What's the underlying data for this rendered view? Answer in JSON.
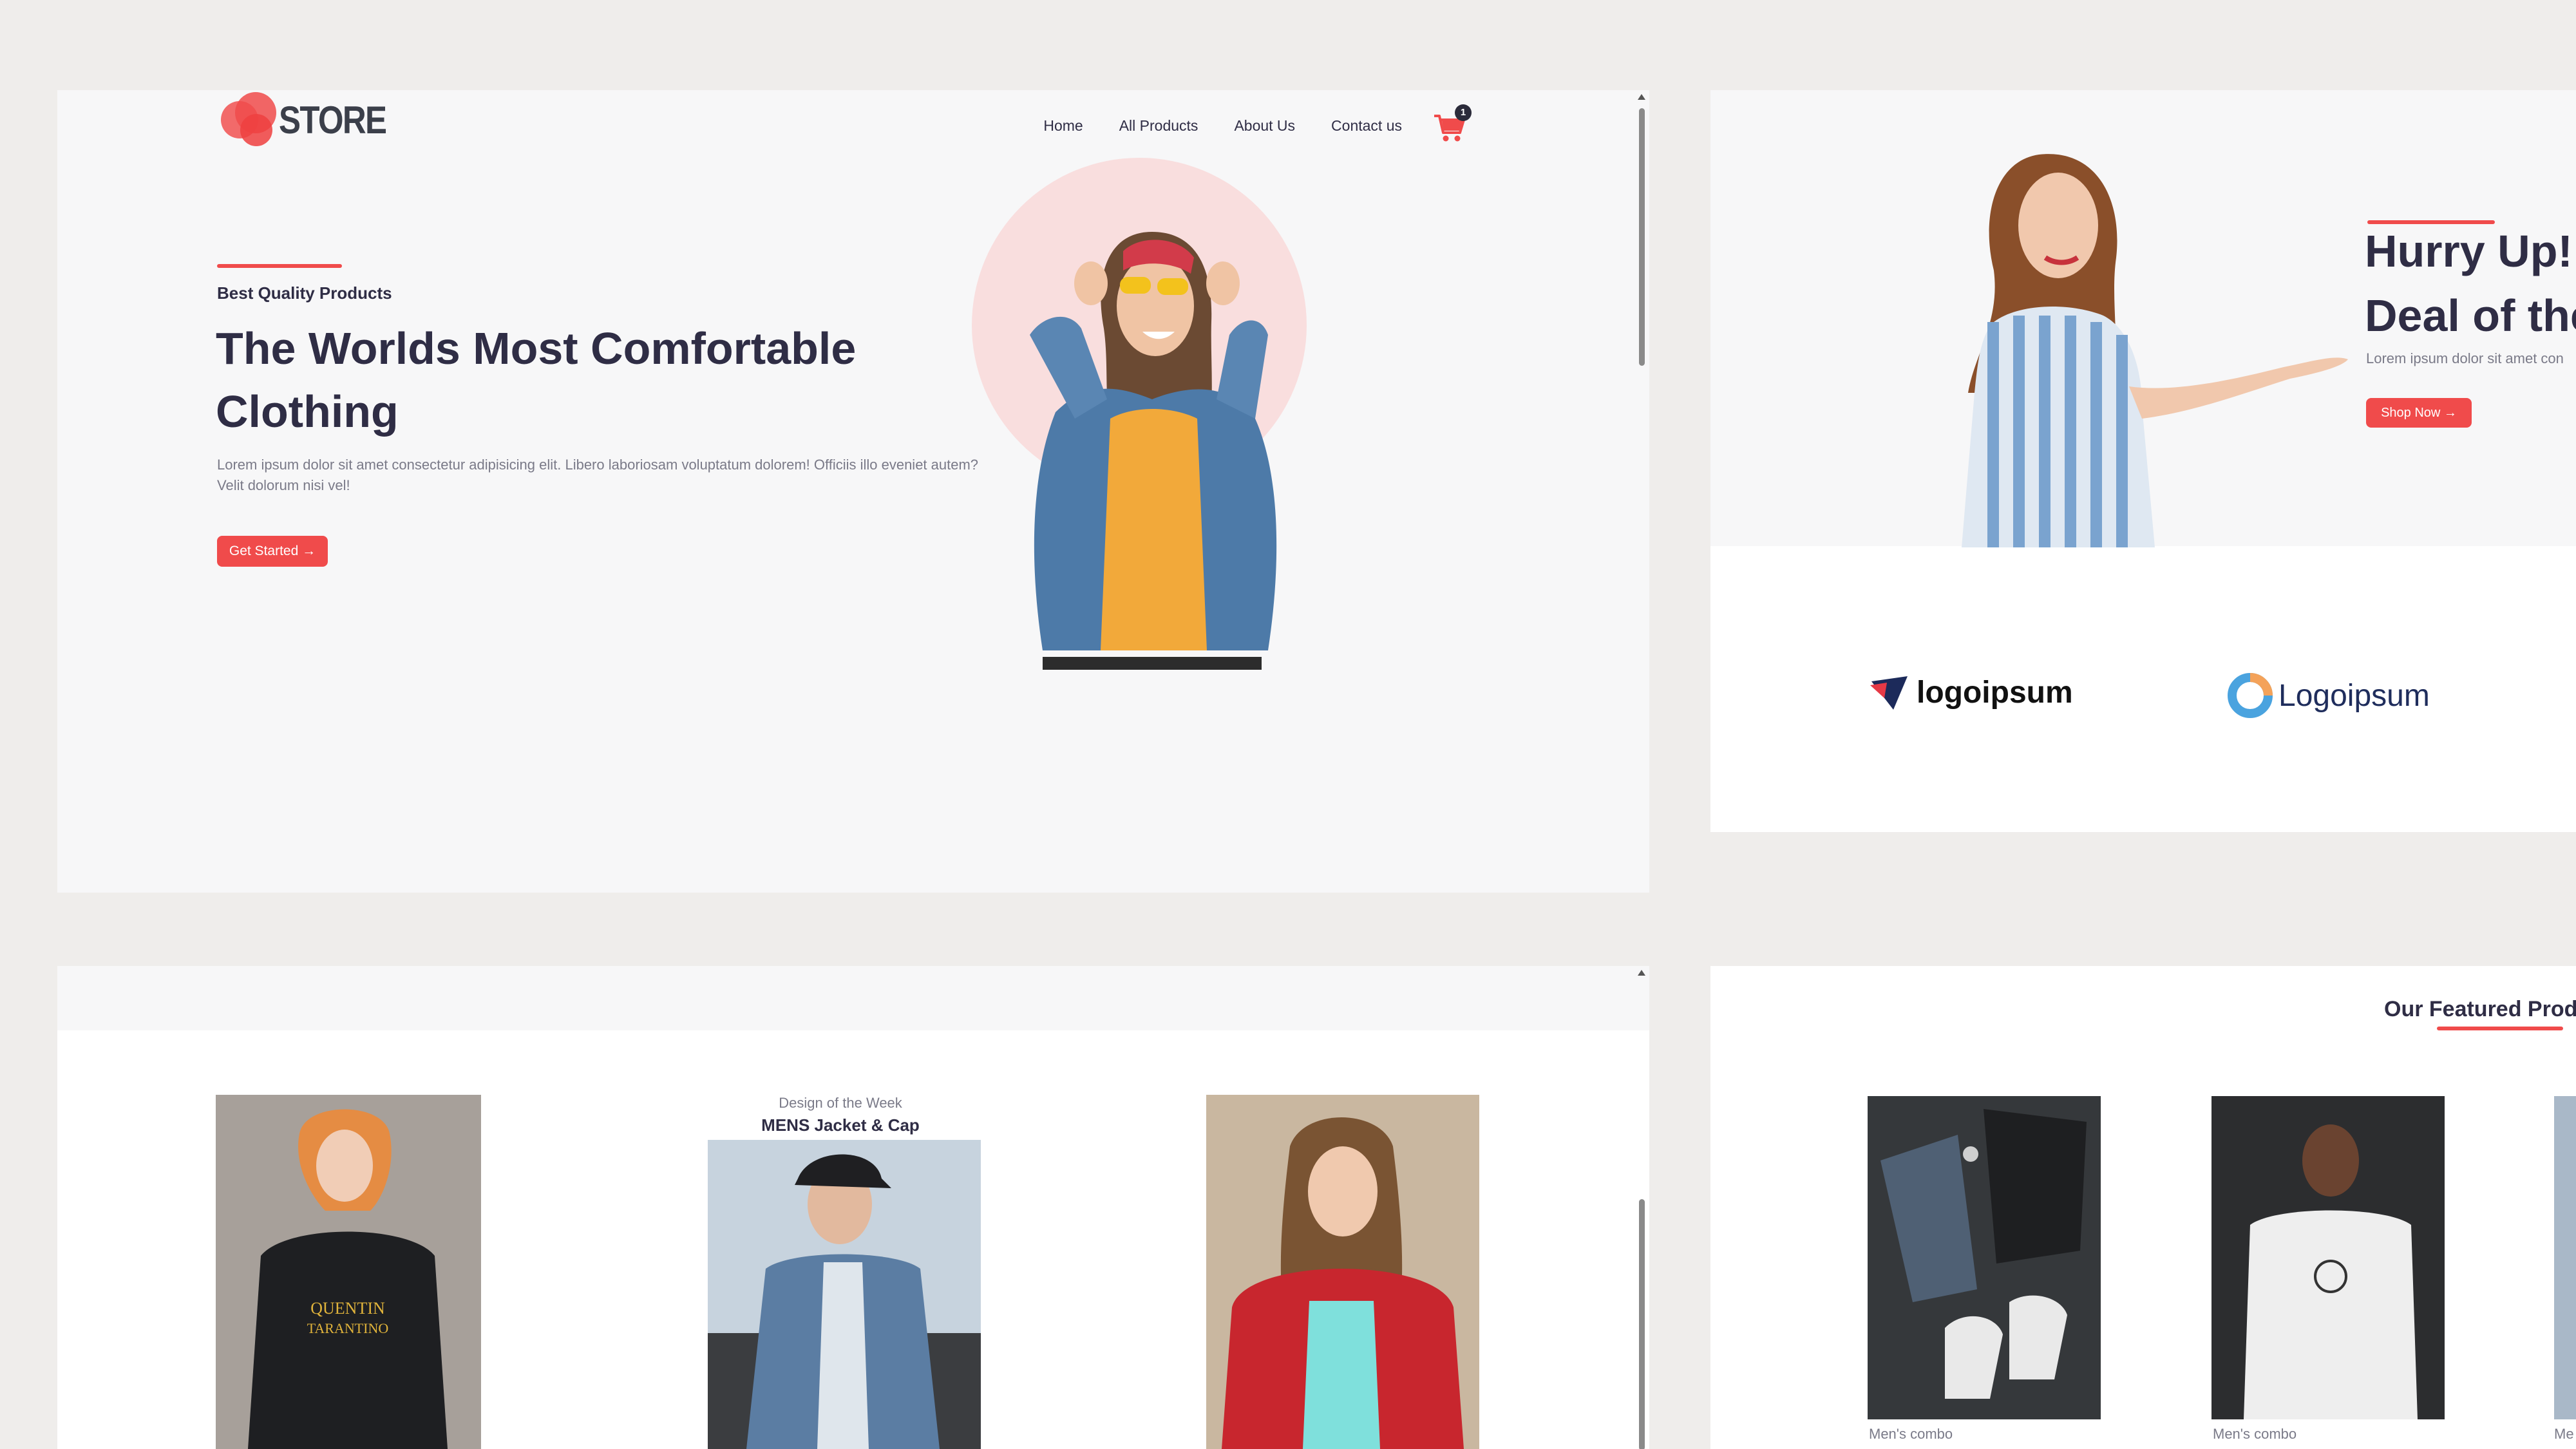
{
  "header": {
    "logo_text": "STORE",
    "nav": [
      "Home",
      "All Products",
      "About Us",
      "Contact us"
    ],
    "cart_count": "1",
    "cart_icon": "shopping-cart-icon"
  },
  "hero": {
    "eyebrow": "Best Quality Products",
    "title": "The Worlds Most Comfortable Clothing",
    "description": "Lorem ipsum dolor sit amet consectetur adipisicing elit. Libero laboriosam voluptatum dolorem! Officiis illo eveniet autem? Velit dolorum nisi vel!",
    "cta": "Get Started →"
  },
  "deal": {
    "title_line1": "Hurry Up!",
    "title_line2": "Deal of the",
    "description": "Lorem ipsum dolor sit amet con",
    "cta": "Shop Now →"
  },
  "brands": [
    "logoipsum",
    "Logoipsum"
  ],
  "design_of_week": {
    "kicker": "Design of the Week",
    "title": "MENS Jacket & Cap"
  },
  "featured": {
    "title": "Our Featured Produ",
    "products": [
      "Men's combo",
      "Men's combo",
      "Me"
    ]
  },
  "colors": {
    "accent": "#f04b4b",
    "text_dark": "#2f2d45",
    "hero_circle": "#f9dede"
  }
}
